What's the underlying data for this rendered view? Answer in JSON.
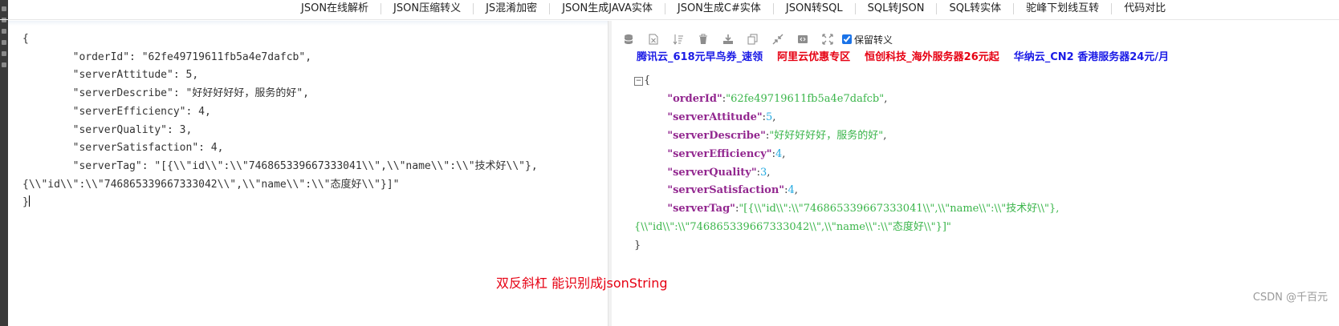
{
  "nav": {
    "items": [
      "JSON在线解析",
      "JSON压缩转义",
      "JS混淆加密",
      "JSON生成JAVA实体",
      "JSON生成C#实体",
      "JSON转SQL",
      "SQL转JSON",
      "SQL转实体",
      "驼峰下划线互转",
      "代码对比"
    ]
  },
  "editor": {
    "lines": [
      "{",
      "        \"orderId\": \"62fe49719611fb5a4e7dafcb\",",
      "        \"serverAttitude\": 5,",
      "        \"serverDescribe\": \"好好好好好，服务的好\",",
      "        \"serverEfficiency\": 4,",
      "        \"serverQuality\": 3,",
      "        \"serverSatisfaction\": 4,",
      "        \"serverTag\": \"[{\\\\\"id\\\\\":\\\\\"746865339667333041\\\\\",\\\\\"name\\\\\":\\\\\"技术好\\\\\"},",
      "{\\\\\"id\\\\\":\\\\\"746865339667333042\\\\\",\\\\\"name\\\\\":\\\\\"态度好\\\\\"}]\"",
      "}"
    ]
  },
  "toolbar": {
    "icons": [
      "database-icon",
      "excel-icon",
      "sort-icon",
      "trash-icon",
      "download-icon",
      "copy-icon",
      "compress-icon",
      "code-icon",
      "expand-icon"
    ],
    "keep_escape_label": "保留转义",
    "keep_escape_checked": true
  },
  "ads": [
    {
      "text": "腾讯云_618元早鸟券_速领",
      "color": "#1a1ae6"
    },
    {
      "text": "阿里云优惠专区",
      "color": "#e60012"
    },
    {
      "text": "恒创科技_海外服务器26元起",
      "color": "#e60012"
    },
    {
      "text": "华纳云_CN2 香港服务器24元/月",
      "color": "#1a1ae6"
    }
  ],
  "tree": {
    "open_brace": "{",
    "close_brace": "}",
    "fold_symbol": "−",
    "entries": [
      {
        "key": "\"orderId\"",
        "value": "\"62fe49719611fb5a4e7dafcb\"",
        "type": "string"
      },
      {
        "key": "\"serverAttitude\"",
        "value": "5",
        "type": "number"
      },
      {
        "key": "\"serverDescribe\"",
        "value": "\"好好好好好，服务的好\"",
        "type": "string"
      },
      {
        "key": "\"serverEfficiency\"",
        "value": "4",
        "type": "number"
      },
      {
        "key": "\"serverQuality\"",
        "value": "3",
        "type": "number"
      },
      {
        "key": "\"serverSatisfaction\"",
        "value": "4",
        "type": "number"
      }
    ],
    "last_key": "\"serverTag\"",
    "last_value_line1": "\"[{\\\\\"id\\\\\":\\\\\"746865339667333041\\\\\",\\\\\"name\\\\\":\\\\\"技术好\\\\\"},",
    "last_value_line2": "{\\\\\"id\\\\\":\\\\\"746865339667333042\\\\\",\\\\\"name\\\\\":\\\\\"态度好\\\\\"}]\""
  },
  "note": "双反斜杠 能识别成jsonString",
  "watermark": "CSDN @千百元"
}
